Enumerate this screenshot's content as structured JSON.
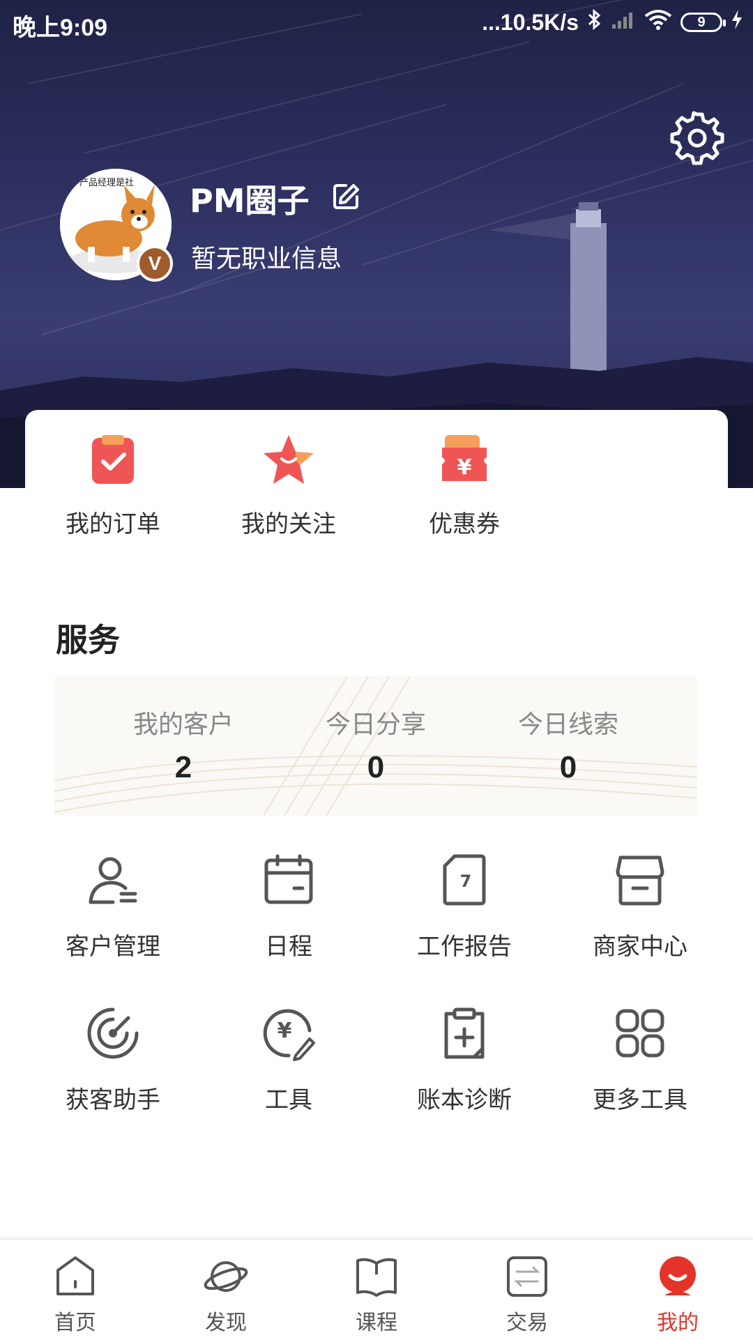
{
  "status_bar": {
    "time": "晚上9:09",
    "network_speed": "...10.5K/s",
    "battery": "9"
  },
  "profile": {
    "username": "PM圈子",
    "job_info": "暂无职业信息",
    "avatar_caption": "产品经理是社",
    "badge": "V"
  },
  "quick_actions": [
    {
      "label": "我的订单",
      "icon": "order-check-icon"
    },
    {
      "label": "我的关注",
      "icon": "star-icon"
    },
    {
      "label": "优惠券",
      "icon": "coupon-yen-icon"
    }
  ],
  "services": {
    "title": "服务",
    "stats": [
      {
        "label": "我的客户",
        "value": "2"
      },
      {
        "label": "今日分享",
        "value": "0"
      },
      {
        "label": "今日线索",
        "value": "0"
      }
    ],
    "tools": [
      {
        "label": "客户管理",
        "icon": "customer-manage-icon"
      },
      {
        "label": "日程",
        "icon": "calendar-icon"
      },
      {
        "label": "工作报告",
        "icon": "work-report-icon"
      },
      {
        "label": "商家中心",
        "icon": "store-icon"
      },
      {
        "label": "获客助手",
        "icon": "radar-icon"
      },
      {
        "label": "工具",
        "icon": "yen-pen-icon"
      },
      {
        "label": "账本诊断",
        "icon": "clipboard-plus-icon"
      },
      {
        "label": "更多工具",
        "icon": "grid-icon"
      }
    ]
  },
  "tabbar": [
    {
      "label": "首页",
      "icon": "home-icon"
    },
    {
      "label": "发现",
      "icon": "planet-icon"
    },
    {
      "label": "课程",
      "icon": "book-icon"
    },
    {
      "label": "交易",
      "icon": "exchange-icon"
    },
    {
      "label": "我的",
      "icon": "profile-icon",
      "active": true
    }
  ],
  "colors": {
    "accent": "#e4342a",
    "hero_bg": "#2c2f5e",
    "icon_gray": "#555555"
  }
}
